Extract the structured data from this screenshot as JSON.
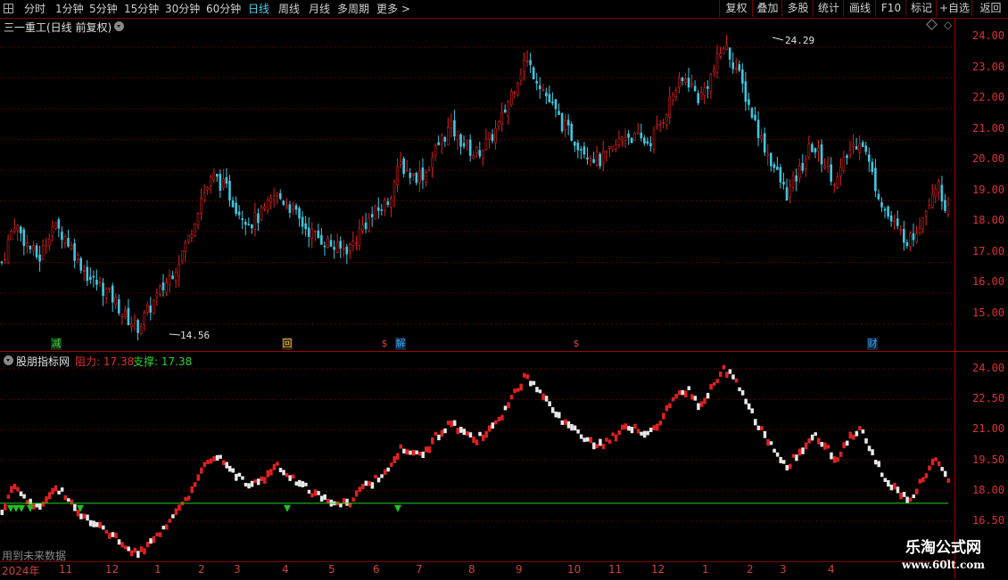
{
  "toolbar": {
    "periods": [
      "分时",
      "1分钟",
      "5分钟",
      "15分钟",
      "30分钟",
      "60分钟",
      "日线",
      "周线",
      "月线",
      "多周期",
      "更多 >"
    ],
    "active_period": "日线",
    "right_buttons": [
      "复权",
      "叠加",
      "多股",
      "统计",
      "画线",
      "F10",
      "标记",
      "+自选",
      "返回"
    ]
  },
  "main_panel": {
    "title": "三一重工(日线 前复权)",
    "high_marker": "24.29",
    "low_marker": "14.56",
    "y_ticks": [
      "24.00",
      "23.00",
      "22.00",
      "21.00",
      "20.00",
      "19.00",
      "18.00",
      "17.00",
      "16.00",
      "15.00"
    ],
    "events": [
      {
        "label": "减",
        "color": "#40d040",
        "bg": "#103010"
      },
      {
        "label": "回",
        "color": "#f0c040",
        "bg": "#302010"
      },
      {
        "label": "$",
        "color": "#e04040",
        "bg": "#000"
      },
      {
        "label": "解",
        "color": "#40a0f0",
        "bg": "#0a2a40"
      },
      {
        "label": "$",
        "color": "#e04040",
        "bg": "#000"
      },
      {
        "label": "财",
        "color": "#40a0f0",
        "bg": "#0a2a40"
      }
    ]
  },
  "indicator_panel": {
    "name": "股朋指标网",
    "resistance_label": "阻力: 17.38",
    "support_label": "支撑: 17.38",
    "y_ticks": [
      "24.00",
      "22.50",
      "21.00",
      "19.50",
      "18.00",
      "16.50"
    ],
    "note": "用到未来数据"
  },
  "time_axis": {
    "labels": [
      "2024年",
      "11",
      "12",
      "1",
      "2",
      "3",
      "4",
      "5",
      "6",
      "7",
      "8",
      "9",
      "10",
      "11",
      "12",
      "1",
      "2",
      "3",
      "4"
    ]
  },
  "watermark": {
    "line1": "乐淘公式网",
    "line2": "www.60lt.com"
  },
  "colors": {
    "up": "#e02020",
    "down": "#40c8e0",
    "support_line": "#20d020",
    "grid": "#5a0000"
  },
  "chart_data": {
    "type": "candlestick",
    "title": "三一重工(日线 前复权)",
    "ylim": [
      14.3,
      24.6
    ],
    "highest": 24.29,
    "lowest": 14.56,
    "close_path": [
      17.0,
      18.3,
      17.6,
      17.1,
      18.2,
      17.9,
      17.2,
      16.5,
      16.2,
      15.8,
      15.2,
      14.9,
      15.6,
      16.2,
      16.9,
      17.8,
      19.1,
      19.8,
      19.4,
      18.7,
      18.3,
      18.6,
      19.2,
      18.9,
      18.3,
      17.9,
      17.7,
      17.4,
      17.5,
      18.2,
      18.6,
      19.0,
      20.2,
      19.8,
      19.9,
      20.8,
      21.4,
      20.9,
      20.5,
      20.9,
      21.5,
      22.6,
      23.6,
      23.0,
      22.2,
      21.5,
      21.0,
      20.6,
      20.3,
      20.6,
      21.2,
      21.0,
      20.9,
      21.6,
      22.6,
      23.0,
      22.3,
      23.1,
      24.1,
      23.3,
      22.1,
      21.0,
      20.1,
      19.2,
      19.9,
      20.8,
      20.3,
      19.6,
      20.6,
      21.1,
      19.7,
      18.6,
      18.0,
      17.7,
      18.6,
      19.6,
      18.7
    ]
  }
}
